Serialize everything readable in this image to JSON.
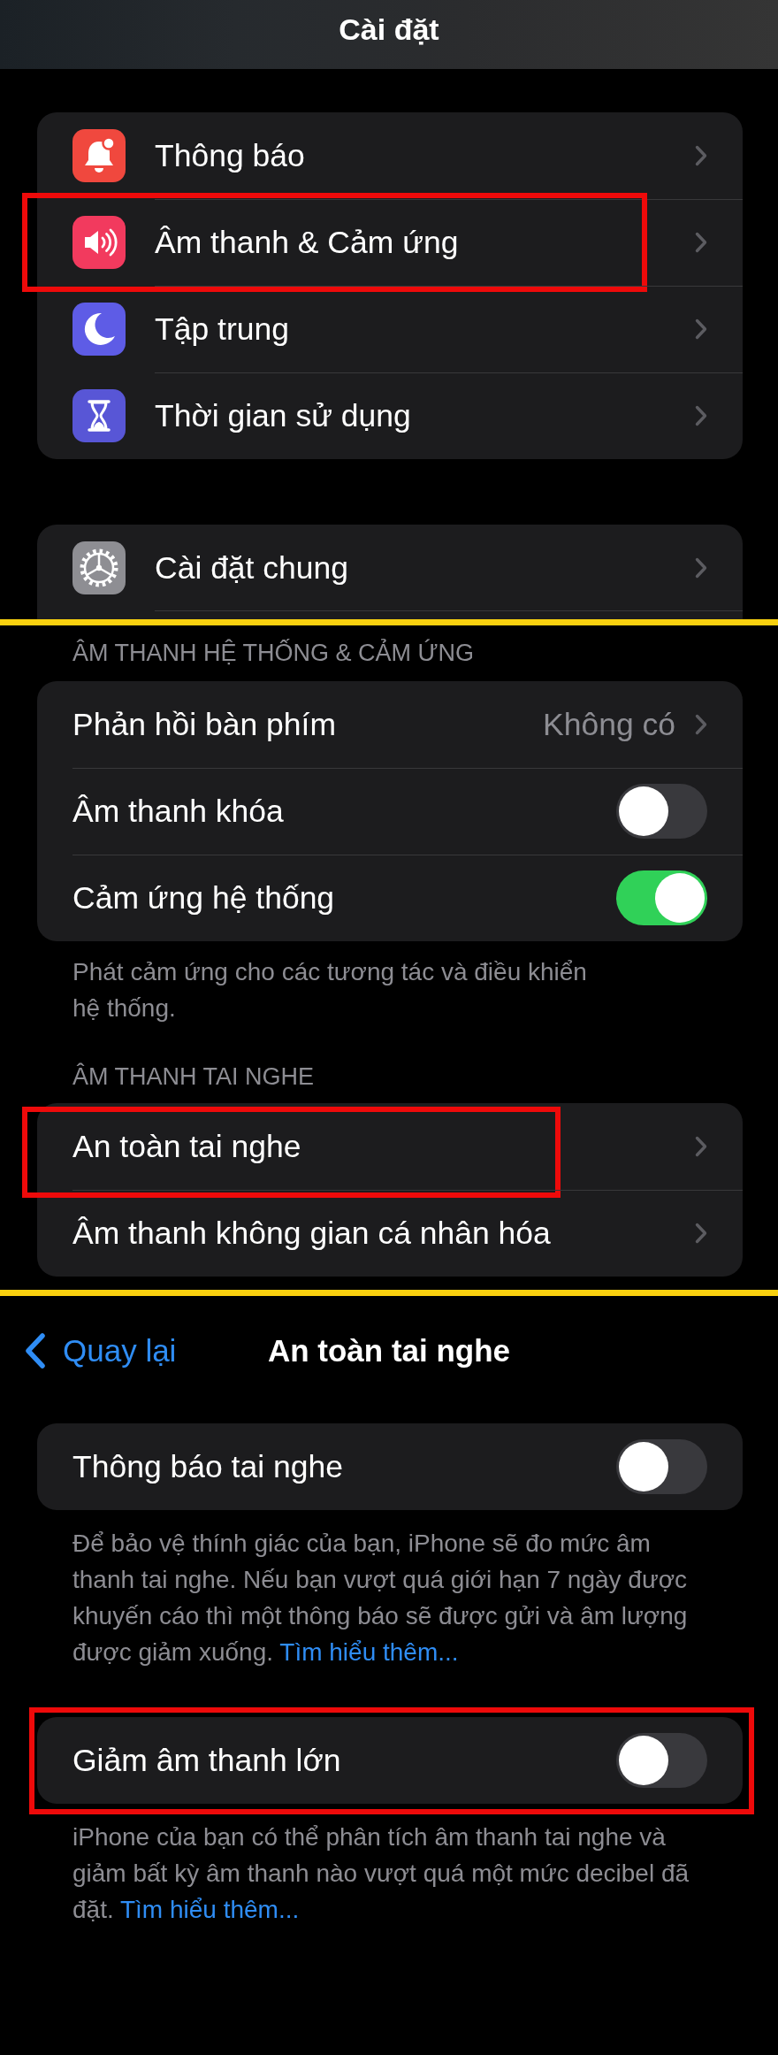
{
  "screens": [
    {
      "kind": "root",
      "title": "Cài đặt",
      "groups": [
        {
          "rows": [
            {
              "kind": "link",
              "label": "Thông báo",
              "color": "#f0483e",
              "highlighted": false
            },
            {
              "kind": "link",
              "label": "Âm thanh & Cảm ứng",
              "color": "#f23a5e",
              "highlighted": true
            },
            {
              "kind": "link",
              "label": "Tập trung",
              "color": "#5e5ce6",
              "highlighted": false
            },
            {
              "kind": "link",
              "label": "Thời gian sử dụng",
              "color": "#5856d6",
              "highlighted": false
            }
          ]
        },
        {
          "rows": [
            {
              "kind": "link",
              "label": "Cài đặt chung",
              "color": "#8e8e93",
              "highlighted": false
            }
          ]
        }
      ]
    },
    {
      "kind": "list",
      "groups": [
        {
          "header": "ÂM THANH HỆ THỐNG & CẢM ỨNG",
          "rows": [
            {
              "kind": "link",
              "label": "Phản hồi bàn phím",
              "value": "Không có",
              "highlighted": false
            },
            {
              "kind": "toggle",
              "label": "Âm thanh khóa",
              "on": false,
              "highlighted": false
            },
            {
              "kind": "toggle",
              "label": "Cảm ứng hệ thống",
              "on": true,
              "highlighted": false
            }
          ],
          "footer": {
            "text": "Phát cảm ứng cho các tương tác và điều khiển hệ thống."
          }
        },
        {
          "header": "ÂM THANH TAI NGHE",
          "rows": [
            {
              "kind": "link",
              "label": "An toàn tai nghe",
              "highlighted": true
            },
            {
              "kind": "link",
              "label": "Âm thanh không gian cá nhân hóa",
              "highlighted": false
            }
          ]
        }
      ]
    },
    {
      "kind": "detail",
      "back": "Quay lại",
      "title": "An toàn tai nghe",
      "groups": [
        {
          "rows": [
            {
              "kind": "toggle",
              "label": "Thông báo tai nghe",
              "on": false,
              "highlighted": false
            }
          ],
          "footer": {
            "text": "Để bảo vệ thính giác của bạn, iPhone sẽ đo mức âm thanh tai nghe. Nếu bạn vượt quá giới hạn 7 ngày được khuyến cáo thì một thông báo sẽ được gửi và âm lượng được giảm xuống.",
            "link": "Tìm hiểu thêm..."
          }
        },
        {
          "rows": [
            {
              "kind": "toggle",
              "label": "Giảm âm thanh lớn",
              "on": false,
              "highlighted": true
            }
          ],
          "footer": {
            "text": "iPhone của bạn có thể phân tích âm thanh tai nghe và giảm bất kỳ âm thanh nào vượt quá một mức decibel đã đặt.",
            "link": "Tìm hiểu thêm..."
          }
        }
      ]
    }
  ]
}
